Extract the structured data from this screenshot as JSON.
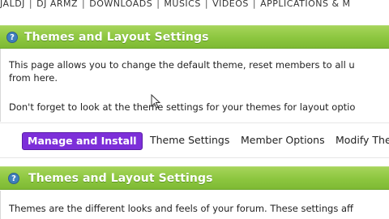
{
  "top_nav": {
    "items": [
      "JALDJ",
      "DJ ARMZ",
      "DOWNLOADS",
      "MUSICS",
      "VIDEOS",
      "APPLICATIONS & M"
    ],
    "separator": "|"
  },
  "section1": {
    "title": "Themes and Layout Settings",
    "help_icon": "?",
    "line1": "This page allows you to change the default theme, reset members to all u",
    "line2": "from here.",
    "line3": "Don't forget to look at the theme settings for your themes for layout optio"
  },
  "tabs": {
    "active": "Manage and Install",
    "items": [
      "Theme Settings",
      "Member Options",
      "Modify The"
    ]
  },
  "section2": {
    "title": "Themes and Layout Settings",
    "help_icon": "?",
    "line1": "Themes are the different looks and feels of your forum. These settings aff"
  },
  "colors": {
    "header_green": "#8cc63f",
    "active_tab_purple": "#7d2fd9",
    "help_icon_blue": "#3f7fbd"
  }
}
